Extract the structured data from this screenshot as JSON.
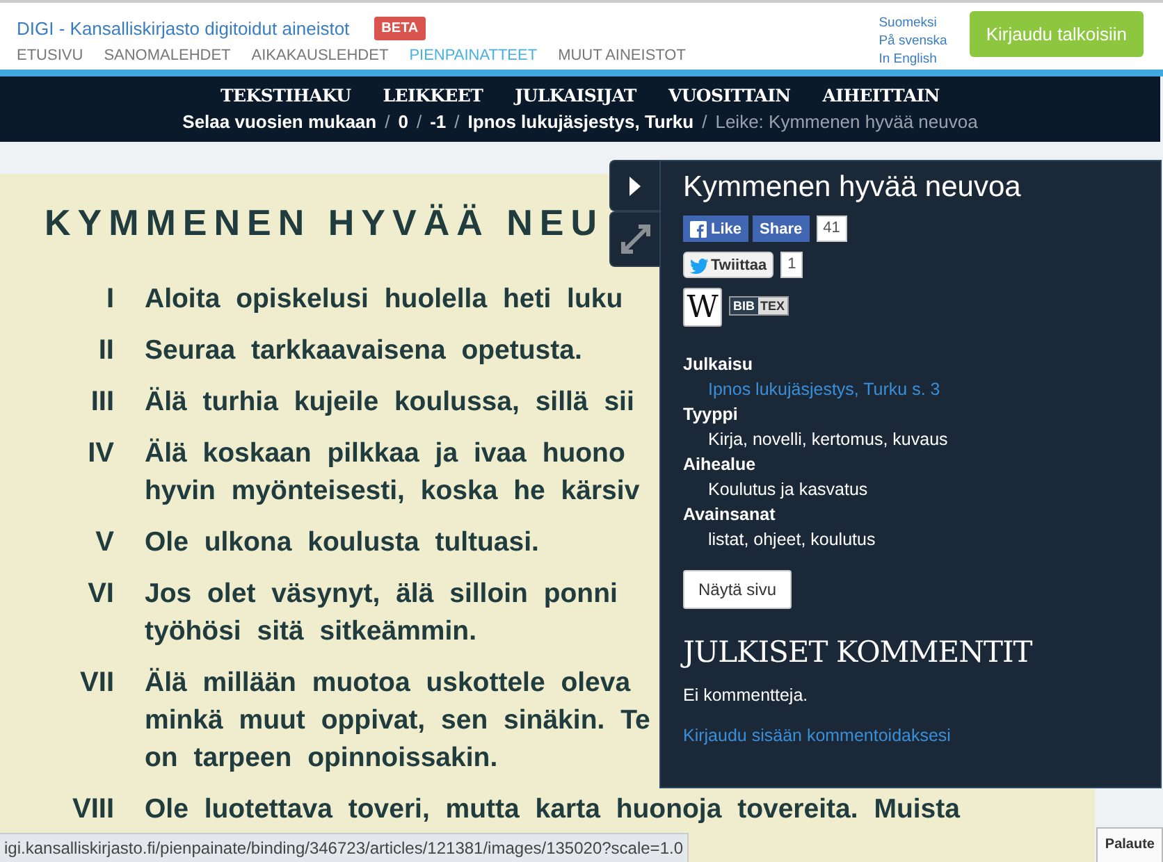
{
  "header": {
    "site_title": "DIGI - Kansalliskirjasto digitoidut aineistot",
    "badge": "BETA",
    "nav": [
      {
        "label": "ETUSIVU",
        "selected": false
      },
      {
        "label": "SANOMALEHDET",
        "selected": false
      },
      {
        "label": "AIKAKAUSLEHDET",
        "selected": false
      },
      {
        "label": "PIENPAINATTEET",
        "selected": true
      },
      {
        "label": "MUUT AINEISTOT",
        "selected": false
      }
    ],
    "languages": [
      "Suomeksi",
      "På svenska",
      "In English"
    ],
    "login_button": "Kirjaudu talkoisiin"
  },
  "main_nav": {
    "items": [
      "TEKSTIHAKU",
      "LEIKKEET",
      "JULKAISIJAT",
      "VUOSITTAIN",
      "AIHEITTAIN"
    ],
    "separator": "/",
    "breadcrumb": [
      {
        "label": "Selaa vuosien mukaan",
        "current": false
      },
      {
        "label": "0",
        "current": false
      },
      {
        "label": "-1",
        "current": false
      },
      {
        "label": "Ipnos lukujäsjestys, Turku",
        "current": false
      },
      {
        "label": "Leike: Kymmenen hyvää neuvoa",
        "current": true
      }
    ]
  },
  "document": {
    "title": "KYMMENEN HYVÄÄ NEU",
    "items": [
      {
        "numeral": "I",
        "lines": [
          "Aloita opiskelusi huolella heti luku"
        ]
      },
      {
        "numeral": "II",
        "lines": [
          "Seuraa tarkkaavaisena opetusta."
        ]
      },
      {
        "numeral": "III",
        "lines": [
          "Älä turhia kujeile koulussa, sillä sii"
        ]
      },
      {
        "numeral": "IV",
        "lines": [
          "Älä koskaan pilkkaa ja ivaa huono",
          "hyvin myönteisesti, koska he kärsiv"
        ]
      },
      {
        "numeral": "V",
        "lines": [
          "Ole ulkona koulusta tultuasi."
        ]
      },
      {
        "numeral": "VI",
        "lines": [
          "Jos olet väsynyt, älä silloin ponni",
          "työhösi sitä sitkeämmin."
        ]
      },
      {
        "numeral": "VII",
        "lines": [
          "Älä millään muotoa uskottele oleva",
          "minkä muut oppivat, sen sinäkin. Te",
          "on tarpeen opinnoissakin."
        ]
      },
      {
        "numeral": "VIII",
        "lines": [
          "Ole luotettava toveri, mutta karta huonoja tovereita. Muista"
        ]
      }
    ]
  },
  "panel": {
    "title": "Kymmenen hyvää neuvoa",
    "facebook": {
      "like": "Like",
      "share": "Share",
      "count": "41"
    },
    "twitter": {
      "label": "Twiittaa",
      "count": "1"
    },
    "wiki_logo": "W",
    "bibtex": [
      "BIB",
      "TEX"
    ],
    "fields": [
      {
        "label": "Julkaisu",
        "value": "Ipnos lukujäsjestys, Turku s. 3",
        "kind": "link"
      },
      {
        "label": "Tyyppi",
        "value": "Kirja, novelli, kertomus, kuvaus",
        "kind": "text"
      },
      {
        "label": "Aihealue",
        "value": "Koulutus ja kasvatus",
        "kind": "text"
      },
      {
        "label": "Avainsanat",
        "value": "listat, ohjeet, koulutus",
        "kind": "text"
      }
    ],
    "show_page_button": "Näytä sivu",
    "comments_heading": "JULKISET KOMMENTIT",
    "no_comments": "Ei kommentteja.",
    "login_link": "Kirjaudu sisään kommentoidaksesi"
  },
  "status_url": "igi.kansalliskirjasto.fi/pienpainate/binding/346723/articles/121381/images/135020?scale=1.0",
  "feedback_button": "Palaute"
}
